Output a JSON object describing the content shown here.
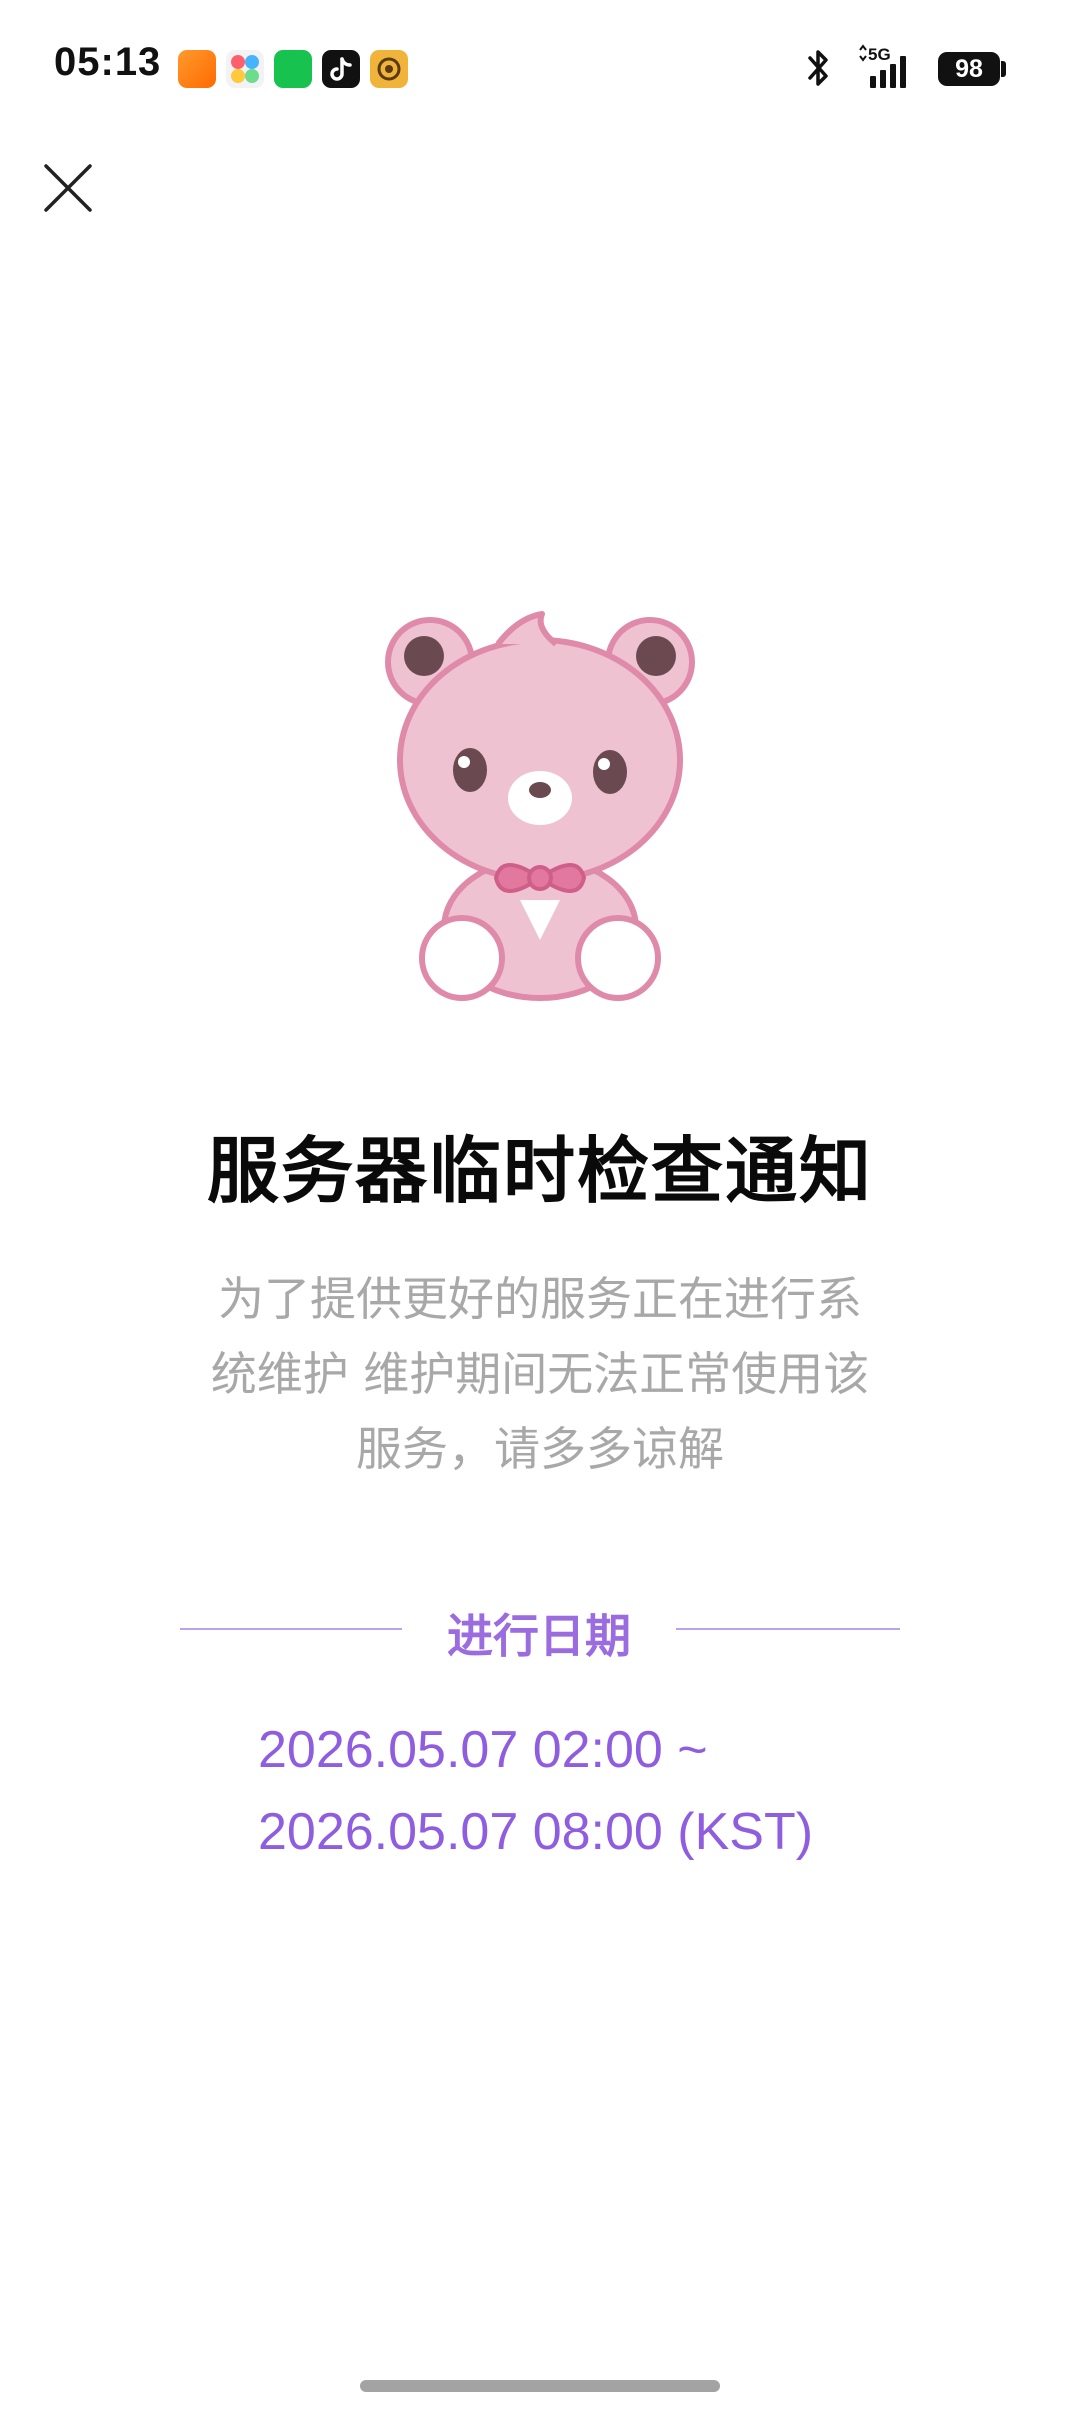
{
  "status_bar": {
    "time": "05:13",
    "network": "5G",
    "battery": "98",
    "app_icons": [
      "taobao-flash-icon",
      "colorful-app-icon",
      "green-app-icon",
      "tiktok-icon",
      "yellow-app-icon"
    ],
    "icons": [
      "bluetooth-icon",
      "signal-icon",
      "battery-icon"
    ]
  },
  "header": {
    "close_icon": "close-icon"
  },
  "notice": {
    "title": "服务器临时检查通知",
    "description_lines": [
      "为了提供更好的服务正在进行系",
      "统维护 维护期间无法正常使用该",
      "服务，请多多谅解"
    ],
    "section_label": "进行日期",
    "date_start": "2026.05.07 02:00 ~",
    "date_end": "2026.05.07 08:00 (KST)"
  },
  "colors": {
    "accent": "#9b6be0",
    "title": "#0a0a0a",
    "description": "#a8a8a8",
    "bear_pink": "#efc2d2",
    "bear_outline": "#e08aaa"
  }
}
